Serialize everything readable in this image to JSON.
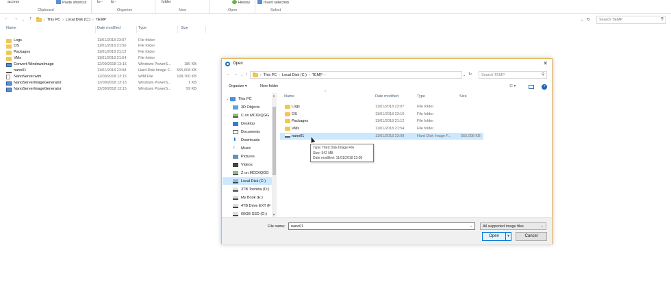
{
  "ribbon": {
    "top_items": [
      "access",
      "Paste shortcut",
      "to -",
      "to -",
      "folder",
      "History",
      "Invert selection"
    ],
    "groups": [
      "Clipboard",
      "Organize",
      "New",
      "Open",
      "Select"
    ]
  },
  "explorer": {
    "breadcrumb": [
      "This PC",
      "Local Disk (C:)",
      "TEMP"
    ],
    "search_placeholder": "Search TEMP",
    "columns": [
      "Name",
      "Date modified",
      "Type",
      "Size"
    ],
    "rows": [
      {
        "name": "Logs",
        "date": "11/01/2018 23:07",
        "type": "File folder",
        "size": "",
        "icon": "folder"
      },
      {
        "name": "OS",
        "date": "11/01/2018 21:50",
        "type": "File folder",
        "size": "",
        "icon": "folder"
      },
      {
        "name": "Packages",
        "date": "11/01/2018 21:12",
        "type": "File folder",
        "size": "",
        "icon": "folder"
      },
      {
        "name": "VMs",
        "date": "11/01/2018 21:54",
        "type": "File folder",
        "size": "",
        "icon": "folder"
      },
      {
        "name": "Convert-WindowsImage",
        "date": "12/09/2018 13:15",
        "type": "Windows PowerS...",
        "size": "180 KB",
        "icon": "powershell"
      },
      {
        "name": "nano01",
        "date": "11/01/2018 23:08",
        "type": "Hard Disk Image F...",
        "size": "555,008 KB",
        "icon": "drive"
      },
      {
        "name": "NanoServer.wim",
        "date": "12/09/2018 13:15",
        "type": "WIM File",
        "size": "168,700 KB",
        "icon": "file"
      },
      {
        "name": "NanoServerImageGenerator",
        "date": "12/09/2018 13:15",
        "type": "Windows PowerS...",
        "size": "1 KB",
        "icon": "powershell"
      },
      {
        "name": "NanoServerImageGenerator",
        "date": "12/09/2018 13:15",
        "type": "Windows PowerS...",
        "size": "99 KB",
        "icon": "powershell"
      }
    ]
  },
  "dialog": {
    "title": "Open",
    "breadcrumb": [
      "This PC",
      "Local Disk (C:)",
      "TEMP"
    ],
    "search_placeholder": "Search TEMP",
    "toolbar": {
      "organize": "Organize ▾",
      "new_folder": "New folder"
    },
    "nav_items": [
      {
        "label": "This PC",
        "icon": "pc"
      },
      {
        "label": "3D Objects",
        "icon": "3d"
      },
      {
        "label": "C on MC0XQGG",
        "icon": "netdrive"
      },
      {
        "label": "Desktop",
        "icon": "desktop"
      },
      {
        "label": "Documents",
        "icon": "documents"
      },
      {
        "label": "Downloads",
        "icon": "downloads"
      },
      {
        "label": "Music",
        "icon": "music"
      },
      {
        "label": "Pictures",
        "icon": "pictures"
      },
      {
        "label": "Videos",
        "icon": "videos"
      },
      {
        "label": "Z on MC0XQGG",
        "icon": "netdrive"
      },
      {
        "label": "Local Disk (C:)",
        "icon": "drive",
        "selected": true
      },
      {
        "label": "3TB Toshiba (D:)",
        "icon": "drive"
      },
      {
        "label": "My Book (E:)",
        "icon": "drive"
      },
      {
        "label": "4TB Drive EXT (F",
        "icon": "drive"
      },
      {
        "label": "60GB SSD (G:)",
        "icon": "drive"
      }
    ],
    "columns": [
      "Name",
      "Date modified",
      "Type",
      "Size"
    ],
    "rows": [
      {
        "name": "Logs",
        "date": "11/01/2018 23:07",
        "type": "File folder",
        "size": "",
        "icon": "folder"
      },
      {
        "name": "OS",
        "date": "11/01/2018 23:10",
        "type": "File folder",
        "size": "",
        "icon": "folder"
      },
      {
        "name": "Packages",
        "date": "11/01/2018 21:12",
        "type": "File folder",
        "size": "",
        "icon": "folder"
      },
      {
        "name": "VMs",
        "date": "11/01/2018 21:54",
        "type": "File folder",
        "size": "",
        "icon": "folder"
      },
      {
        "name": "nano01",
        "date": "11/01/2018 23:08",
        "type": "Hard Disk Image F...",
        "size": "555,008 KB",
        "icon": "drive",
        "selected": true
      }
    ],
    "tooltip": {
      "type": "Type: Hard Disk Image File",
      "size": "Size: 542 MB",
      "date": "Date modified: 11/01/2018 23:08"
    },
    "file_name_label": "File name:",
    "file_name_value": "nano01",
    "filter": "All supported image files",
    "open_label": "Open",
    "cancel_label": "Cancel"
  }
}
